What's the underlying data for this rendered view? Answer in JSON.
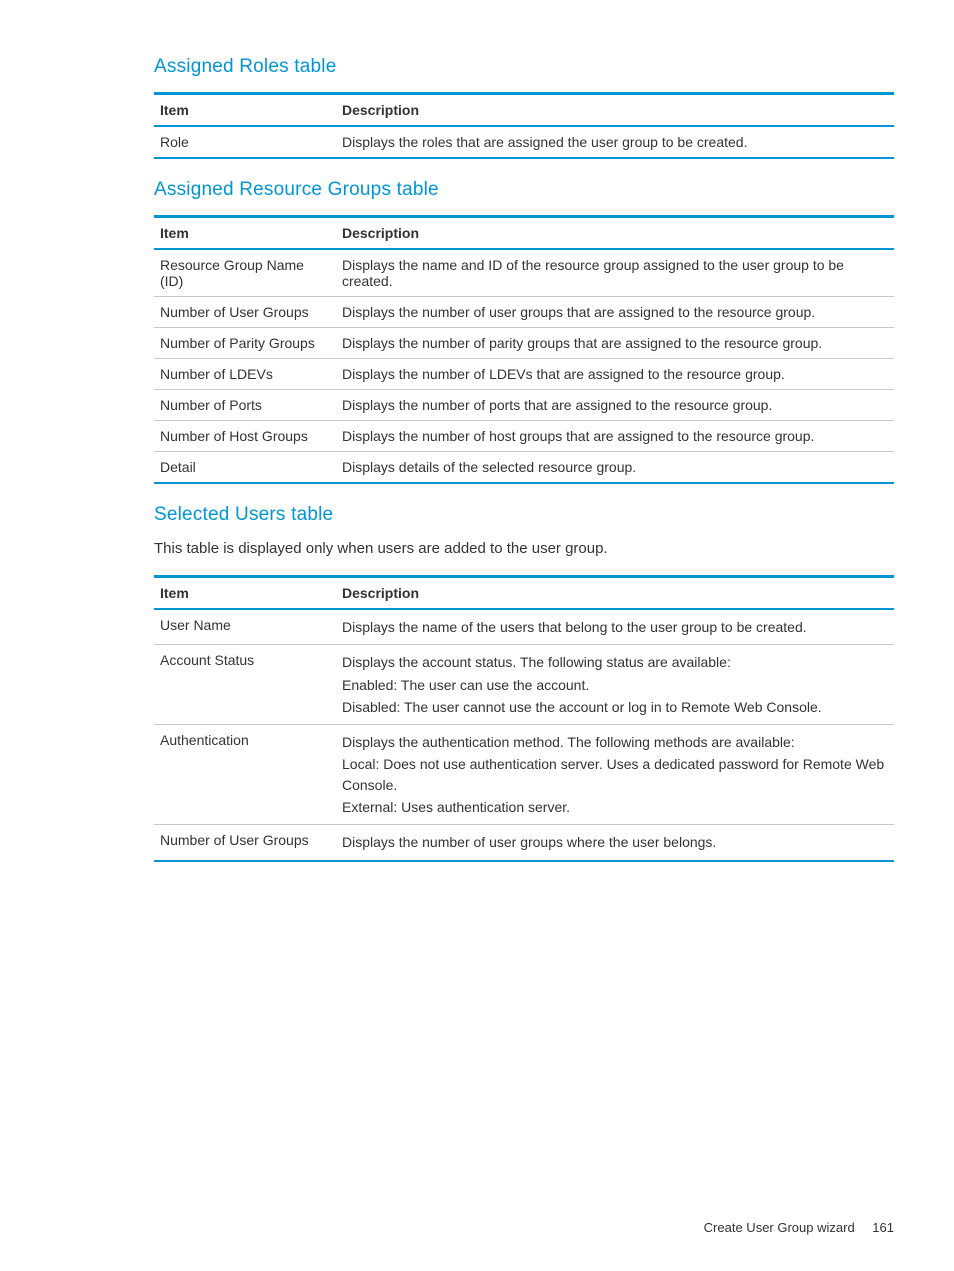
{
  "sections": {
    "assigned_roles": {
      "heading": "Assigned Roles table",
      "headers": {
        "item": "Item",
        "description": "Description"
      },
      "rows": [
        {
          "item": "Role",
          "description": "Displays the roles that are assigned the user group to be created."
        }
      ]
    },
    "assigned_resource_groups": {
      "heading": "Assigned Resource Groups table",
      "headers": {
        "item": "Item",
        "description": "Description"
      },
      "rows": [
        {
          "item": "Resource Group Name (ID)",
          "description": "Displays the name and ID of the resource group assigned to the user group to be created."
        },
        {
          "item": "Number of User Groups",
          "description": "Displays the number of user groups that are assigned to the resource group."
        },
        {
          "item": "Number of Parity Groups",
          "description": "Displays the number of parity groups that are assigned to the resource group."
        },
        {
          "item": "Number of LDEVs",
          "description": "Displays the number of LDEVs that are assigned to the resource group."
        },
        {
          "item": "Number of Ports",
          "description": "Displays the number of ports that are assigned to the resource group."
        },
        {
          "item": "Number of Host Groups",
          "description": "Displays the number of host groups that are assigned to the resource group."
        },
        {
          "item": "Detail",
          "description": "Displays details of the selected resource group."
        }
      ]
    },
    "selected_users": {
      "heading": "Selected Users table",
      "intro": "This table is displayed only when users are added to the user group.",
      "headers": {
        "item": "Item",
        "description": "Description"
      },
      "rows": [
        {
          "item": "User Name",
          "description": [
            "Displays the name of the users that belong to the user group to be created."
          ]
        },
        {
          "item": "Account Status",
          "description": [
            "Displays the account status. The following status are available:",
            "Enabled: The user can use the account.",
            "Disabled: The user cannot use the account or log in to Remote Web Console."
          ]
        },
        {
          "item": "Authentication",
          "description": [
            "Displays the authentication method. The following methods are available:",
            "Local: Does not use authentication server. Uses a dedicated password for Remote Web Console.",
            "External: Uses authentication server."
          ]
        },
        {
          "item": "Number of User Groups",
          "description": [
            "Displays the number of user groups where the user belongs."
          ]
        }
      ]
    }
  },
  "footer": {
    "title": "Create User Group wizard",
    "page": "161"
  }
}
